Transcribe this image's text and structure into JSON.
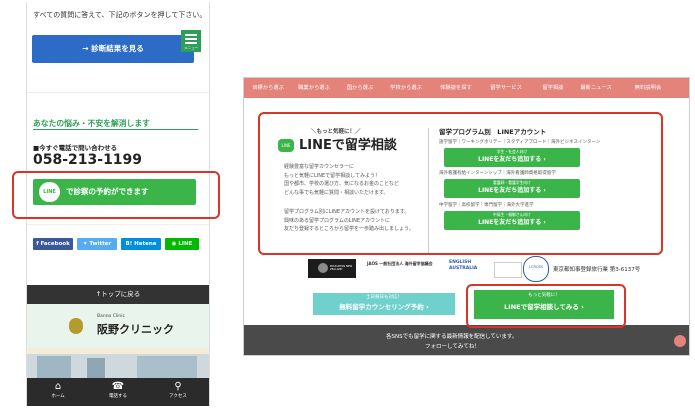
{
  "left": {
    "top_text": "すべての質問に答えて、下記のボタンを押して下さい。",
    "diagnose_button": "→ 診断結果を見る",
    "menu_label": "メニュー",
    "worry_heading": "あなたの悩み・不安を解消します",
    "phone_label": "■今すぐ電話で問い合わせる",
    "phone_number": "058-213-1199",
    "line_icon_text": "LINE",
    "line_button": "で診察の予約ができます",
    "share": [
      {
        "label": "Facebook",
        "color": "#3b5998"
      },
      {
        "label": "Twitter",
        "color": "#55acee"
      },
      {
        "label": "Hatena",
        "color": "#008fde"
      },
      {
        "label": "LINE",
        "color": "#00b900"
      }
    ],
    "back_to_top": "↑トップに戻る",
    "clinic_en": "Banno Clinic",
    "clinic_jp": "阪野クリニック",
    "bottom_nav": [
      "ホーム",
      "電話する",
      "アクセス"
    ]
  },
  "right": {
    "nav": [
      "目標から選ぶ",
      "職業から選ぶ",
      "国から選ぶ",
      "学校から選ぶ",
      "体験談を探す",
      "留学サービス",
      "留学相談",
      "最新ニュース",
      "無料説明会"
    ],
    "small_head": "＼もっと気軽に！／",
    "line_title": "LINEで留学相談",
    "desc1": "経験豊富な留学カウンセラーに\nもっと気軽にLINEで留学相談してみよう！\n国や都市、学校の選び方、気になるお金のことなど\nどんな事でも気軽に質問・相談いただけます。",
    "desc2": "留学プログラム別にLINEアカウントを設けております。\n興味のある留学プログラムのLINEアカウントに\n友だち登録するところから留学を一歩踏み出しましょう。",
    "program_head": "留学プログラム別　LINEアカウント",
    "programs": [
      {
        "caption": "語学留学｜ワーキングホリデー｜スタディアブロード｜海外ビジネスインターン",
        "sub": "学生・社会人向け",
        "button": "LINEを友だち追加する ›"
      },
      {
        "caption": "海外看護有給インターンシップ｜海外看護師資格取得留学",
        "sub": "看護師・看護学生向け",
        "button": "LINEを友だち追加する ›"
      },
      {
        "caption": "中学留学｜高校留学｜専門留学｜海外大学進学",
        "sub": "中高生・親御さん向け",
        "button": "LINEを友だち追加する ›"
      }
    ],
    "logos": [
      "EDUCATION NEW ZEALAND",
      "JAOS 一般社団法人 海外留学協議会",
      "ENGLISH AUSTRALIA",
      "J-CROSS"
    ],
    "registration": "東京都知事登録旅行業 第3-6137号",
    "counsel_sub": "土日祝日も対応！",
    "counsel_btn": "無料留学カウンセリング予約 ›",
    "line_cta_sub": "もっと気軽に！",
    "line_cta_btn": "LINEで留学相談してみる ›",
    "footer_text1": "各SNSでも留学に関する最新情報を配信しています。",
    "footer_text2": "フォローしてみてね！"
  }
}
